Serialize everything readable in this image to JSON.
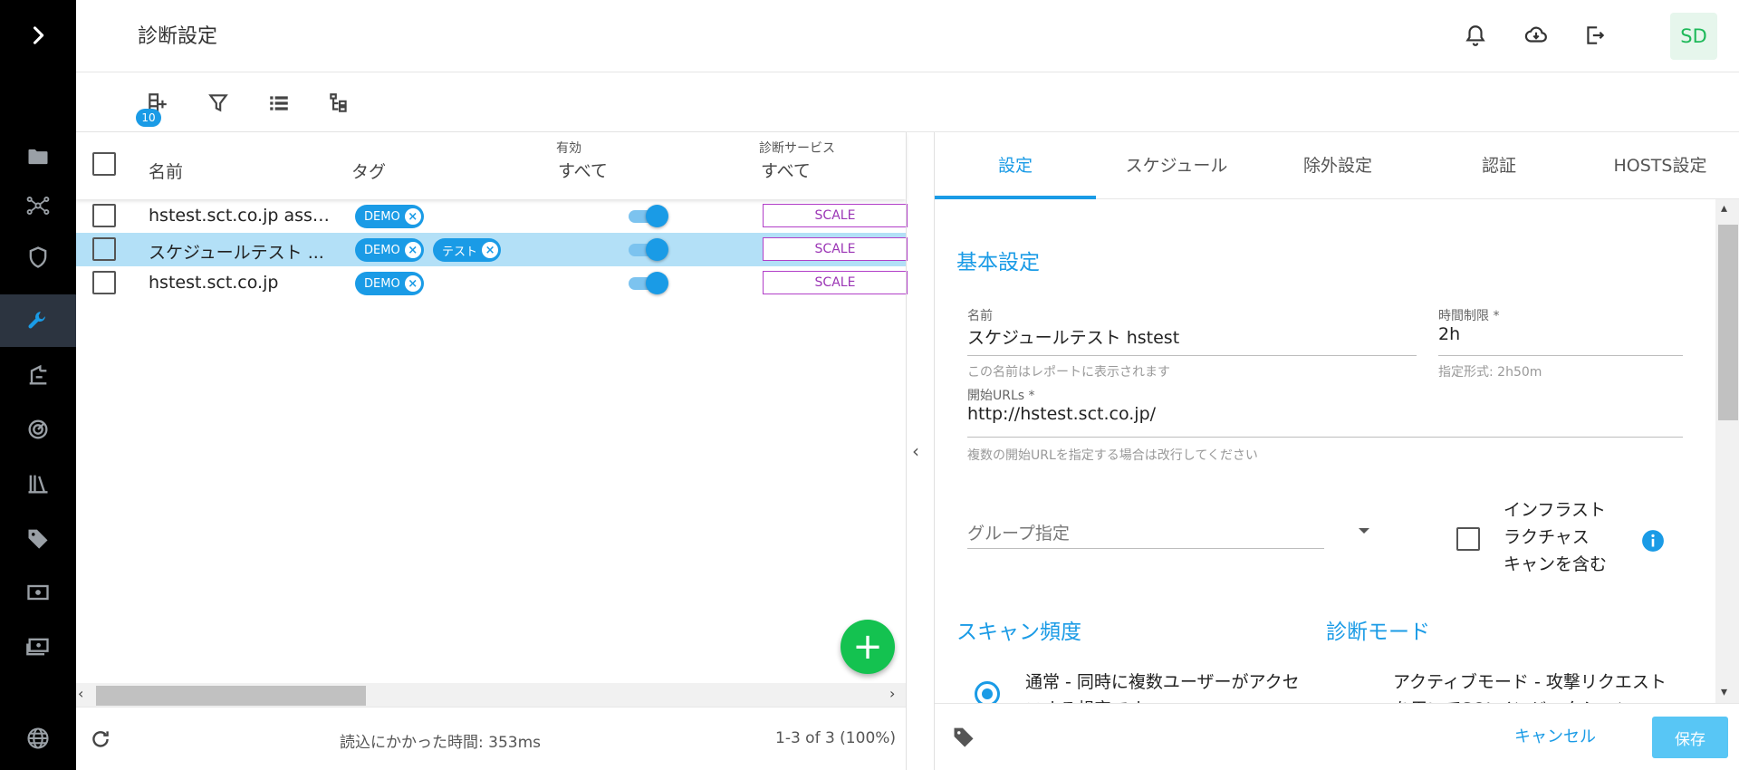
{
  "header": {
    "title": "診断設定",
    "avatar": "SD"
  },
  "toolbar": {
    "add_badge": "10"
  },
  "list": {
    "columns": {
      "name": "名前",
      "tag": "タグ",
      "enabled_label": "有効",
      "enabled_filter": "すべて",
      "service_label": "診断サービス",
      "service_filter": "すべて"
    },
    "rows": [
      {
        "name": "hstest.sct.co.jp asset...",
        "tags": [
          "DEMO"
        ],
        "enabled": true,
        "service": "SCALE",
        "selected": false
      },
      {
        "name": "スケジュールテスト ...",
        "tags": [
          "DEMO",
          "テスト"
        ],
        "enabled": true,
        "service": "SCALE",
        "selected": true
      },
      {
        "name": "hstest.sct.co.jp",
        "tags": [
          "DEMO"
        ],
        "enabled": true,
        "service": "SCALE",
        "selected": false
      }
    ],
    "fab": "+",
    "footer": {
      "load_time": "読込にかかった時間: 353ms",
      "count": "1-3 of 3 (100%)"
    }
  },
  "detail": {
    "tabs": [
      "設定",
      "スケジュール",
      "除外設定",
      "認証",
      "HOSTS設定"
    ],
    "active_tab": 0,
    "basic_section": "基本設定",
    "name_label": "名前",
    "name_value": "スケジュールテスト hstest",
    "name_hint": "この名前はレポートに表示されます",
    "time_label": "時間制限 *",
    "time_value": "2h",
    "time_hint": "指定形式: 2h50m",
    "urls_label": "開始URLs *",
    "urls_value": "http://hstest.sct.co.jp/",
    "urls_hint": "複数の開始URLを指定する場合は改行してください",
    "group_placeholder": "グループ指定",
    "infra_label_1": "インフラスト",
    "infra_label_2": "ラクチャス",
    "infra_label_3": "キャンを含む",
    "scan_freq_section": "スキャン頻度",
    "diag_mode_section": "診断モード",
    "scan_option_1": "通常 - 同時に複数ユーザーがアクセ",
    "scan_option_1b": "スする想定です",
    "mode_option_1": "アクティブモード - 攻撃リクエスト",
    "mode_option_1b": "を用いてSQLインジェクション",
    "cancel": "キャンセル",
    "save": "保存"
  },
  "colors": {
    "accent": "#1a9be6",
    "fab": "#14c250",
    "service_border": "#b23fc8",
    "selected_row": "#b3e0f7"
  }
}
